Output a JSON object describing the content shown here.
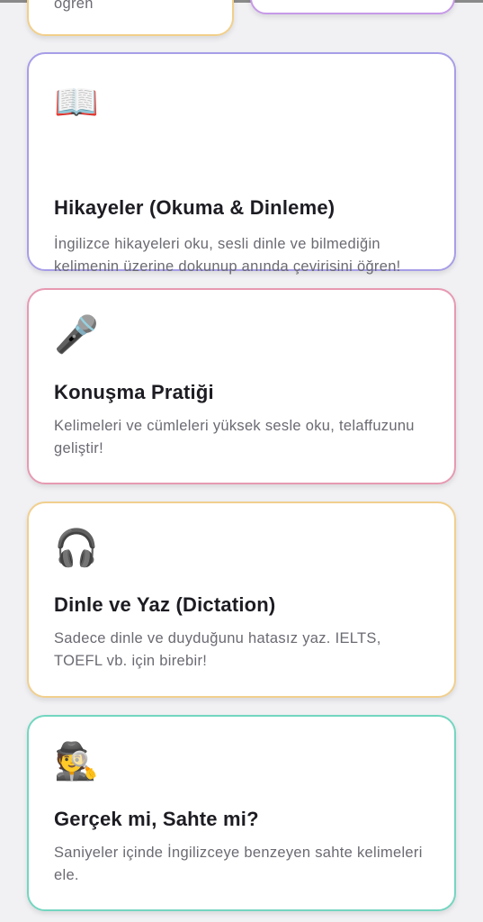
{
  "partial_cards": {
    "left_desc_tail": "öğren"
  },
  "cards": [
    {
      "icon": "📖",
      "icon_name": "open-book-icon",
      "title": "Hikayeler (Okuma & Dinleme)",
      "description": "İngilizce hikayeleri oku, sesli dinle ve bilmediğin kelimenin üzerine dokunup anında çevirisini öğren!",
      "border_color": "#a79ee8"
    },
    {
      "icon": "🎤",
      "icon_name": "microphone-icon",
      "title": "Konuşma Pratiği",
      "description": "Kelimeleri ve cümleleri yüksek sesle oku, telaffuzunu geliştir!",
      "border_color": "#e79ab2"
    },
    {
      "icon": "🎧",
      "icon_name": "headphones-icon",
      "title": "Dinle ve Yaz (Dictation)",
      "description": "Sadece dinle ve duyduğunu hatasız yaz. IELTS, TOEFL vb. için birebir!",
      "border_color": "#f1cf8e"
    },
    {
      "icon": "🕵️",
      "icon_name": "detective-icon",
      "title": "Gerçek mi, Sahte mi?",
      "description": "Saniyeler içinde İngilizceye benzeyen sahte kelimeleri ele.",
      "border_color": "#73d6c0"
    }
  ]
}
